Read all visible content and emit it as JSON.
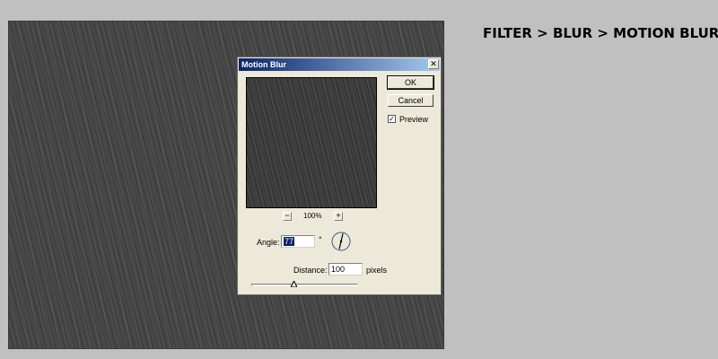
{
  "caption": "FILTER > BLUR > MOTION BLUR",
  "dialog": {
    "title": "Motion Blur",
    "close_glyph": "✕",
    "ok_label": "OK",
    "cancel_label": "Cancel",
    "preview_label": "Preview",
    "preview_checked": true,
    "zoom_out": "−",
    "zoom_in": "+",
    "zoom_level": "100%",
    "angle_label": "Angle:",
    "angle_value": "77",
    "degree_symbol": "°",
    "distance_label": "Distance:",
    "distance_value": "100",
    "distance_unit": "pixels",
    "distance_slider_fraction": 0.4
  }
}
